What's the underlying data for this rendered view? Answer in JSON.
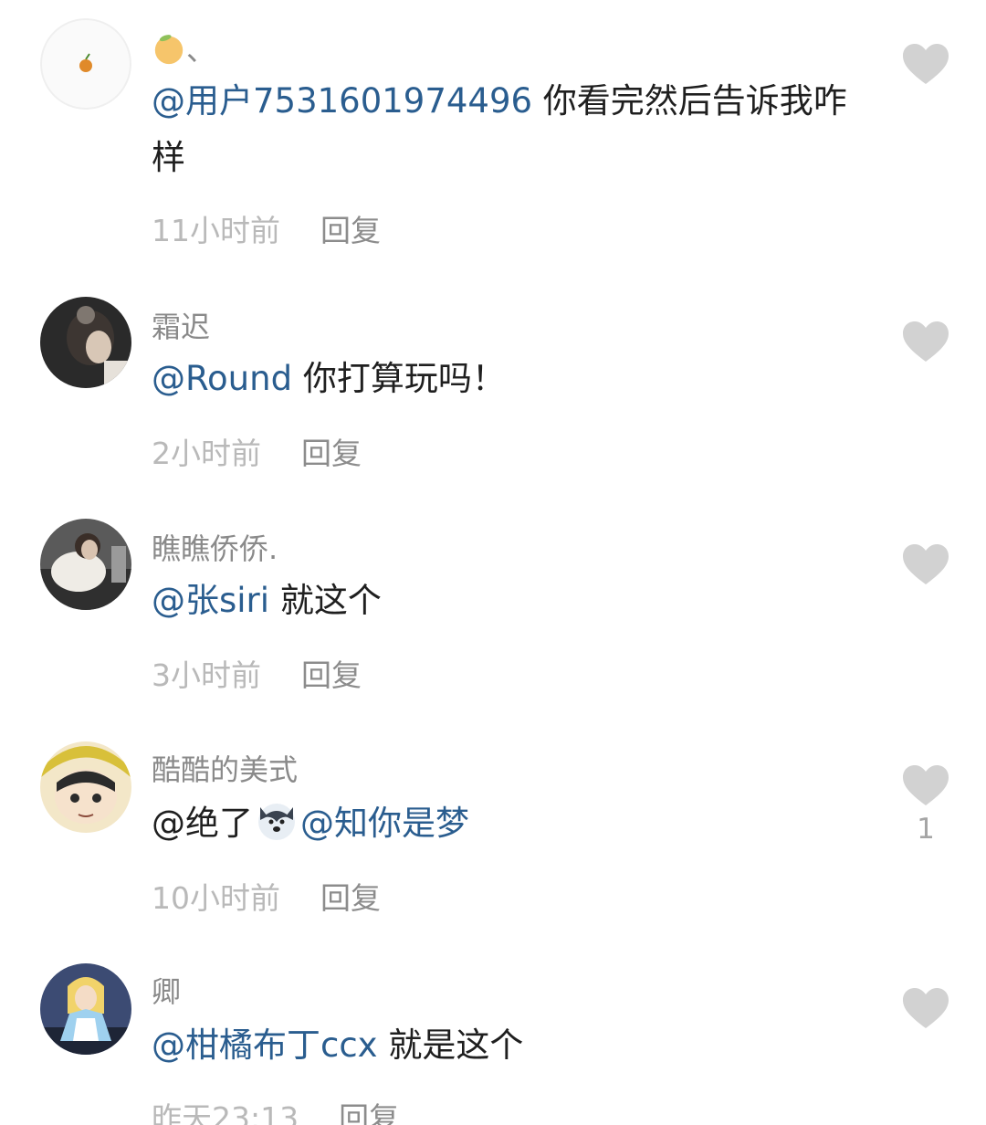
{
  "comments": [
    {
      "username": "、",
      "mention": "@用户7531601974496",
      "text": " 你看完然后告诉我咋样",
      "time": "11小时前",
      "reply": "回复",
      "likes": ""
    },
    {
      "username": "霜迟",
      "mention": "@Round",
      "text": " 你打算玩吗！",
      "time": "2小时前",
      "reply": "回复",
      "likes": ""
    },
    {
      "username": "瞧瞧侨侨.",
      "mention": "@张siri",
      "text": " 就这个",
      "time": "3小时前",
      "reply": "回复",
      "likes": ""
    },
    {
      "username": "酷酷的美式",
      "text_before": "@绝了",
      "mention": "@知你是梦",
      "time": "10小时前",
      "reply": "回复",
      "likes": "1"
    },
    {
      "username": "卿",
      "mention": "@柑橘布丁ccx",
      "text": " 就是这个",
      "time": "昨天23:13",
      "reply": "回复",
      "likes": ""
    }
  ],
  "icons": {
    "like": "heart-icon",
    "emoji": "dog-face-emoji-icon",
    "name_emoji": "orange-emoji-icon"
  },
  "colors": {
    "mention": "#2a5d8f",
    "heart": "#d2d2d2"
  }
}
